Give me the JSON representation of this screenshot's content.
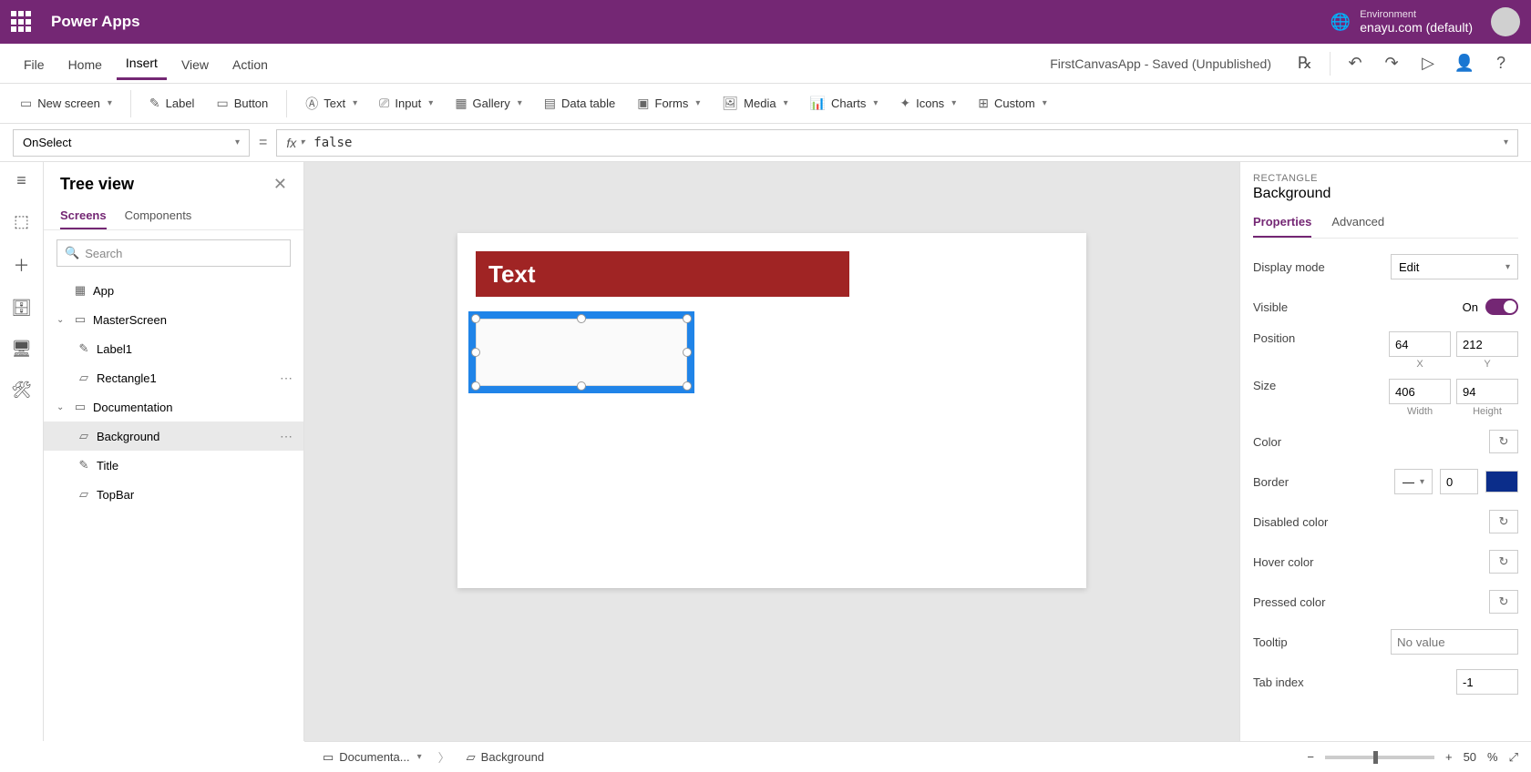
{
  "header": {
    "app_title": "Power Apps",
    "env_label": "Environment",
    "env_value": "enayu.com (default)"
  },
  "commandbar": {
    "tabs": [
      "File",
      "Home",
      "Insert",
      "View",
      "Action"
    ],
    "active": "Insert",
    "status": "FirstCanvasApp - Saved (Unpublished)"
  },
  "ribbon": {
    "new_screen": "New screen",
    "label": "Label",
    "button": "Button",
    "text": "Text",
    "input": "Input",
    "gallery": "Gallery",
    "data_table": "Data table",
    "forms": "Forms",
    "media": "Media",
    "charts": "Charts",
    "icons": "Icons",
    "custom": "Custom"
  },
  "formula": {
    "property": "OnSelect",
    "fx": "fx",
    "value": "false"
  },
  "tree": {
    "title": "Tree view",
    "tabs": {
      "screens": "Screens",
      "components": "Components"
    },
    "search_placeholder": "Search",
    "app": "App",
    "master_screen": "MasterScreen",
    "label1": "Label1",
    "rectangle1": "Rectangle1",
    "documentation": "Documentation",
    "background": "Background",
    "title_item": "Title",
    "topbar": "TopBar"
  },
  "canvas": {
    "text_label": "Text"
  },
  "breadcrumb": {
    "screen": "Documenta...",
    "element": "Background"
  },
  "zoom": {
    "value": "50",
    "unit": "%"
  },
  "props": {
    "type": "RECTANGLE",
    "name": "Background",
    "tabs": {
      "properties": "Properties",
      "advanced": "Advanced"
    },
    "display_mode": {
      "label": "Display mode",
      "value": "Edit"
    },
    "visible": {
      "label": "Visible",
      "state": "On"
    },
    "position": {
      "label": "Position",
      "x": "64",
      "y": "212",
      "xl": "X",
      "yl": "Y"
    },
    "size": {
      "label": "Size",
      "w": "406",
      "h": "94",
      "wl": "Width",
      "hl": "Height"
    },
    "color": {
      "label": "Color"
    },
    "border": {
      "label": "Border",
      "width": "0"
    },
    "disabled_color": {
      "label": "Disabled color"
    },
    "hover_color": {
      "label": "Hover color"
    },
    "pressed_color": {
      "label": "Pressed color"
    },
    "tooltip": {
      "label": "Tooltip",
      "placeholder": "No value"
    },
    "tab_index": {
      "label": "Tab index",
      "value": "-1"
    }
  }
}
